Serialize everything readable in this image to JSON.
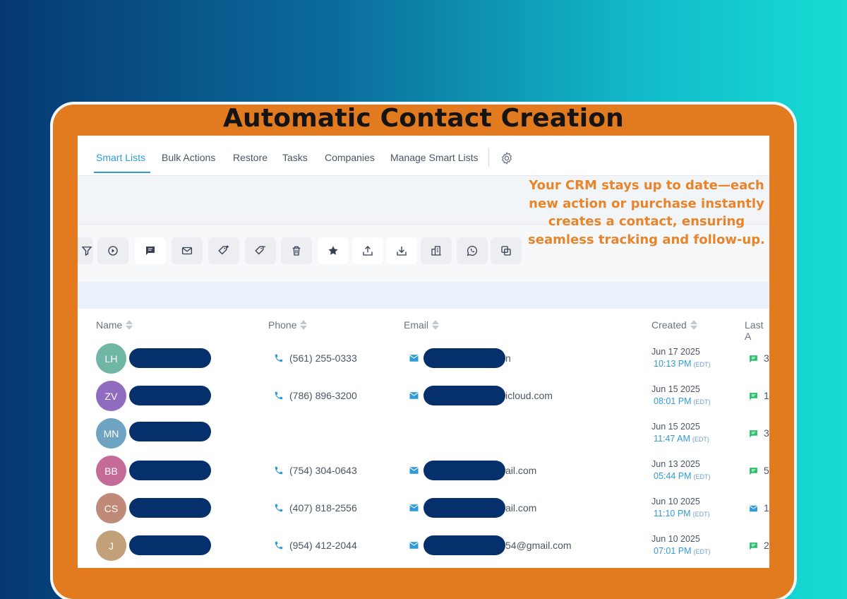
{
  "headline": "Automatic Contact Creation",
  "overlay_text": "Your CRM stays up to date—each new action or purchase instantly creates a contact, ensuring seamless tracking and follow-up.",
  "colors": {
    "accent": "#2f9bd6",
    "frame": "#e27a1f",
    "redaction": "#06306b",
    "overlay_text": "#e8852a"
  },
  "tabs": [
    {
      "label": "Smart Lists",
      "active": true
    },
    {
      "label": "Bulk Actions",
      "active": false
    },
    {
      "label": "Restore",
      "active": false
    },
    {
      "label": "Tasks",
      "active": false
    },
    {
      "label": "Companies",
      "active": false
    },
    {
      "label": "Manage Smart Lists",
      "active": false
    }
  ],
  "settings_icon": "gear-icon",
  "toolbar": [
    "filter-icon",
    "automation-icon",
    "sms-icon",
    "email-icon",
    "add-tag-icon",
    "remove-tag-icon",
    "delete-icon",
    "star-icon",
    "export-icon",
    "import-icon",
    "company-icon",
    "whatsapp-icon",
    "merge-icon"
  ],
  "table": {
    "columns": [
      "Name",
      "Phone",
      "Email",
      "Created",
      "Last A"
    ],
    "rows": [
      {
        "initials": "LH",
        "avatar_color": "#6fb6a5",
        "phone": "(561) 255-0333",
        "email": "",
        "email_visible": "n",
        "date": "Jun 17 2025",
        "time": "10:13 PM",
        "tz": "(EDT)",
        "activity_icon": "message-icon",
        "activity": "3"
      },
      {
        "initials": "ZV",
        "avatar_color": "#8f6cc0",
        "phone": "(786) 896-3200",
        "email": "icloud.com",
        "date": "Jun 15 2025",
        "time": "08:01 PM",
        "tz": "(EDT)",
        "activity_icon": "message-icon",
        "activity": "1"
      },
      {
        "initials": "MN",
        "avatar_color": "#6fa3c2",
        "phone": "",
        "email": "",
        "date": "Jun 15 2025",
        "time": "11:47 AM",
        "tz": "(EDT)",
        "activity_icon": "message-icon",
        "activity": "3"
      },
      {
        "initials": "BB",
        "avatar_color": "#c46b97",
        "phone": "(754) 304-0643",
        "email": "ail.com",
        "date": "Jun 13 2025",
        "time": "05:44 PM",
        "tz": "(EDT)",
        "activity_icon": "message-icon",
        "activity": "5"
      },
      {
        "initials": "CS",
        "avatar_color": "#c08a78",
        "phone": "(407) 818-2556",
        "email": "ail.com",
        "date": "Jun 10 2025",
        "time": "11:10 PM",
        "tz": "(EDT)",
        "activity_icon": "mail-icon",
        "activity": "1"
      },
      {
        "initials": "J",
        "avatar_color": "#c2a07a",
        "phone": "(954) 412-2044",
        "email": "54@gmail.com",
        "date": "Jun 10 2025",
        "time": "07:01 PM",
        "tz": "(EDT)",
        "activity_icon": "message-icon",
        "activity": "2"
      }
    ]
  }
}
